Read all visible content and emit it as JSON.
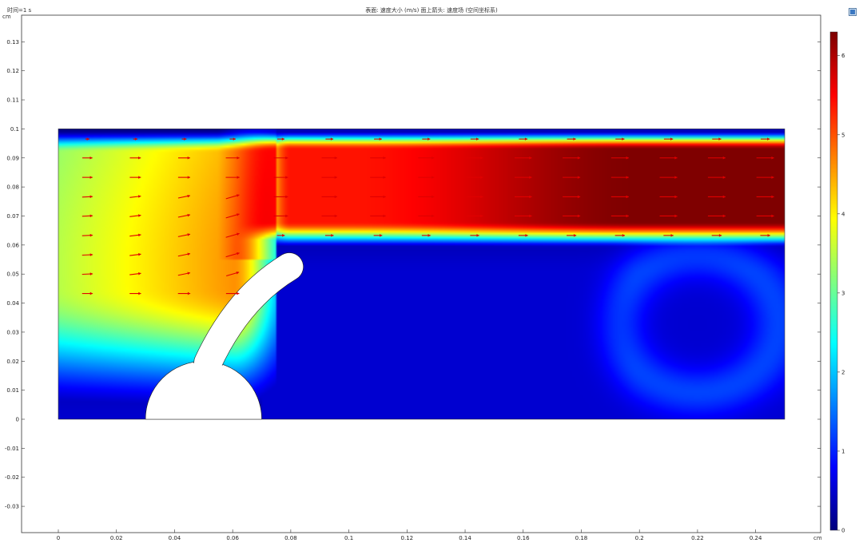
{
  "header": {
    "time_label": "时间=1 s",
    "plot_title": "表面: 速度大小 (m/s)  面上箭头: 速度场  (空间坐标系)",
    "y_unit": "cm",
    "x_unit": "cm"
  },
  "icons": {
    "toolbar": "screenshot-icon"
  },
  "colors": {
    "arrow": "#e00000",
    "colormap": [
      "#00007f",
      "#0000ff",
      "#0080ff",
      "#00ffff",
      "#80ff80",
      "#ffff00",
      "#ff8000",
      "#ff0000",
      "#7f0000"
    ]
  },
  "chart_data": {
    "type": "heatmap",
    "title": "表面: 速度大小 (m/s)  面上箭头: 速度场  (空间坐标系)",
    "xlabel": "cm",
    "ylabel": "cm",
    "xlim": [
      -0.012,
      0.262
    ],
    "ylim": [
      -0.039,
      0.14
    ],
    "x_ticks": [
      0,
      0.02,
      0.04,
      0.06,
      0.08,
      0.1,
      0.12,
      0.14,
      0.16,
      0.18,
      0.2,
      0.22,
      0.24
    ],
    "y_ticks": [
      -0.03,
      -0.02,
      -0.01,
      0,
      0.01,
      0.02,
      0.03,
      0.04,
      0.05,
      0.06,
      0.07,
      0.08,
      0.09,
      0.1,
      0.11,
      0.12,
      0.13
    ],
    "domain": {
      "x": [
        0,
        0.25
      ],
      "y": [
        0,
        0.1
      ]
    },
    "colorbar": {
      "min": 0,
      "max": 6.3,
      "ticks": [
        0,
        1,
        2,
        3,
        4,
        5,
        6
      ]
    },
    "obstacles": {
      "semicircle": {
        "center": [
          0.05,
          0
        ],
        "radius": 0.02
      },
      "arm": {
        "start": [
          0.0515,
          0.0195
        ],
        "bend": [
          0.062,
          0.042
        ],
        "end": [
          0.0795,
          0.0525
        ],
        "width": 0.0095
      }
    },
    "jet": {
      "x_start": 0.07,
      "y_range": [
        0.062,
        0.099
      ],
      "peak_speed": 6.3
    },
    "vortex": {
      "center": [
        0.22,
        0.033
      ]
    },
    "arrows": {
      "x": [
        0.01,
        0.0265,
        0.0433,
        0.06,
        0.0766,
        0.0933,
        0.11,
        0.1266,
        0.1433,
        0.16,
        0.1766,
        0.1933,
        0.21,
        0.2266,
        0.2433
      ],
      "y": [
        0.0965,
        0.09,
        0.0833,
        0.0766,
        0.07,
        0.0633,
        0.0566,
        0.05,
        0.0433
      ]
    }
  }
}
